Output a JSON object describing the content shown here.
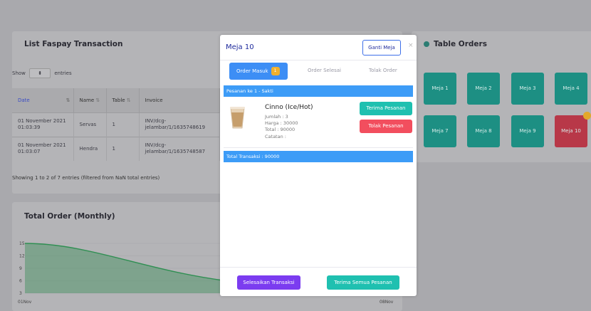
{
  "faspay": {
    "title": "List Faspay Transaction",
    "show_label": "Show",
    "show_select": "⬍",
    "entries_label": "entries",
    "columns": [
      "Date",
      "Name",
      "Table",
      "Invoice"
    ],
    "sort_icons": [
      "⇅",
      "⇅",
      "⇅"
    ],
    "rows": [
      {
        "date_l1": "01 November 2021",
        "date_l2": "01:03:39",
        "name": "Servas",
        "table": "1",
        "inv_l1": "INV/dcg-",
        "inv_l2": "jelambar/1/1635748619"
      },
      {
        "date_l1": "01 November 2021",
        "date_l2": "01:03:07",
        "name": "Hendra",
        "table": "1",
        "inv_l1": "INV/dcg-",
        "inv_l2": "jelambar/1/1635748587"
      }
    ],
    "showing": "Showing 1 to 2 of 7 entries (filtered from NaN total entries)"
  },
  "total_order": {
    "title": "Total Order (Monthly)"
  },
  "chart_data": {
    "type": "area",
    "title": "Total Order (Monthly)",
    "y_ticks": [
      "15",
      "12",
      "9",
      "6",
      "3"
    ],
    "x_tick_labels": [
      "01Nov",
      "08Nov"
    ],
    "x": [
      "01Nov",
      "08Nov"
    ],
    "series": [
      {
        "values": [
          15,
          6
        ]
      }
    ],
    "ylim": [
      3,
      15
    ],
    "color": "#2f8f52"
  },
  "table_orders": {
    "title": "Table Orders",
    "tables": [
      {
        "label": "Meja 1",
        "status": "green"
      },
      {
        "label": "Meja 2",
        "status": "green"
      },
      {
        "label": "Meja 3",
        "status": "green"
      },
      {
        "label": "Meja 4",
        "status": "green"
      },
      {
        "label": "Meja 7",
        "status": "green"
      },
      {
        "label": "Meja 8",
        "status": "green"
      },
      {
        "label": "Meja 9",
        "status": "green"
      },
      {
        "label": "Meja 10",
        "status": "red"
      }
    ]
  },
  "modal": {
    "title": "Meja 10",
    "ganti_label": "Ganti Meja",
    "close_glyph": "×",
    "tabs": {
      "active": "Order Masuk",
      "active_badge": "1",
      "selesai": "Order Selesai",
      "tolak": "Tolak Order"
    },
    "pesanan_header": "Pesanan ke 1 - Sakti",
    "product": {
      "name": "Cinno (Ice/Hot)",
      "jumlah": "Jumlah : 3",
      "harga": "Harga : 30000",
      "total": "Total : 90000",
      "catatan": "Catatan :"
    },
    "terima_label": "Terima Pesanan",
    "tolak_label": "Tolak Pesanan",
    "total_transaksi": "Total Transaksi : 90000",
    "selesaikan_label": "Selesaikan Transaksi",
    "terima_semua_label": "Terima Semua Pesanan"
  },
  "colors": {
    "teal": "#1fc0b0",
    "red": "#f24e5e",
    "purple": "#7b3cf0",
    "blue": "#3d9cf7",
    "yellow_badge": "#f0b02d"
  }
}
